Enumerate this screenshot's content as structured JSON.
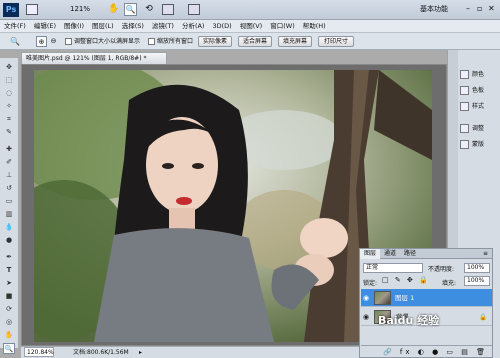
{
  "titlebar": {
    "logo": "Ps",
    "zoom": "121%",
    "workspace": "基本功能",
    "icons": [
      "layout-icon",
      "hand-icon",
      "zoom-tool-icon",
      "rotate-icon",
      "arrange-icon",
      "screen-mode-icon"
    ]
  },
  "menu": [
    "文件(F)",
    "编辑(E)",
    "图像(I)",
    "图层(L)",
    "选择(S)",
    "滤镜(T)",
    "分析(A)",
    "3D(D)",
    "视图(V)",
    "窗口(W)",
    "帮助(H)"
  ],
  "options": {
    "resize_windows": "调整窗口大小以满屏显示",
    "zoom_all": "缩放所有窗口",
    "actual_pixels": "实际像素",
    "fit_screen": "适合屏幕",
    "fill_screen": "填充屏幕",
    "print_size": "打印尺寸"
  },
  "document": {
    "tab_title": "唯美图片.psd @ 121% (图层 1, RGB/8#) *",
    "zoom_status": "120.84%",
    "doc_size": "文档:800.6K/1.56M"
  },
  "right_panel": {
    "items": [
      "颜色",
      "色板",
      "样式",
      "调整",
      "蒙版"
    ]
  },
  "layers_panel": {
    "tabs": [
      "图层",
      "通道",
      "路径"
    ],
    "blend_mode": "正常",
    "opacity_label": "不透明度:",
    "opacity": "100%",
    "lock_label": "锁定:",
    "fill_label": "填充:",
    "fill": "100%",
    "layers": [
      {
        "name": "图层 1",
        "selected": true
      },
      {
        "name": "背景",
        "selected": false
      }
    ]
  },
  "watermark": "Baidu 经验",
  "colors": {
    "selection": "#3d8ee0",
    "accent": "#2f6fb6"
  }
}
